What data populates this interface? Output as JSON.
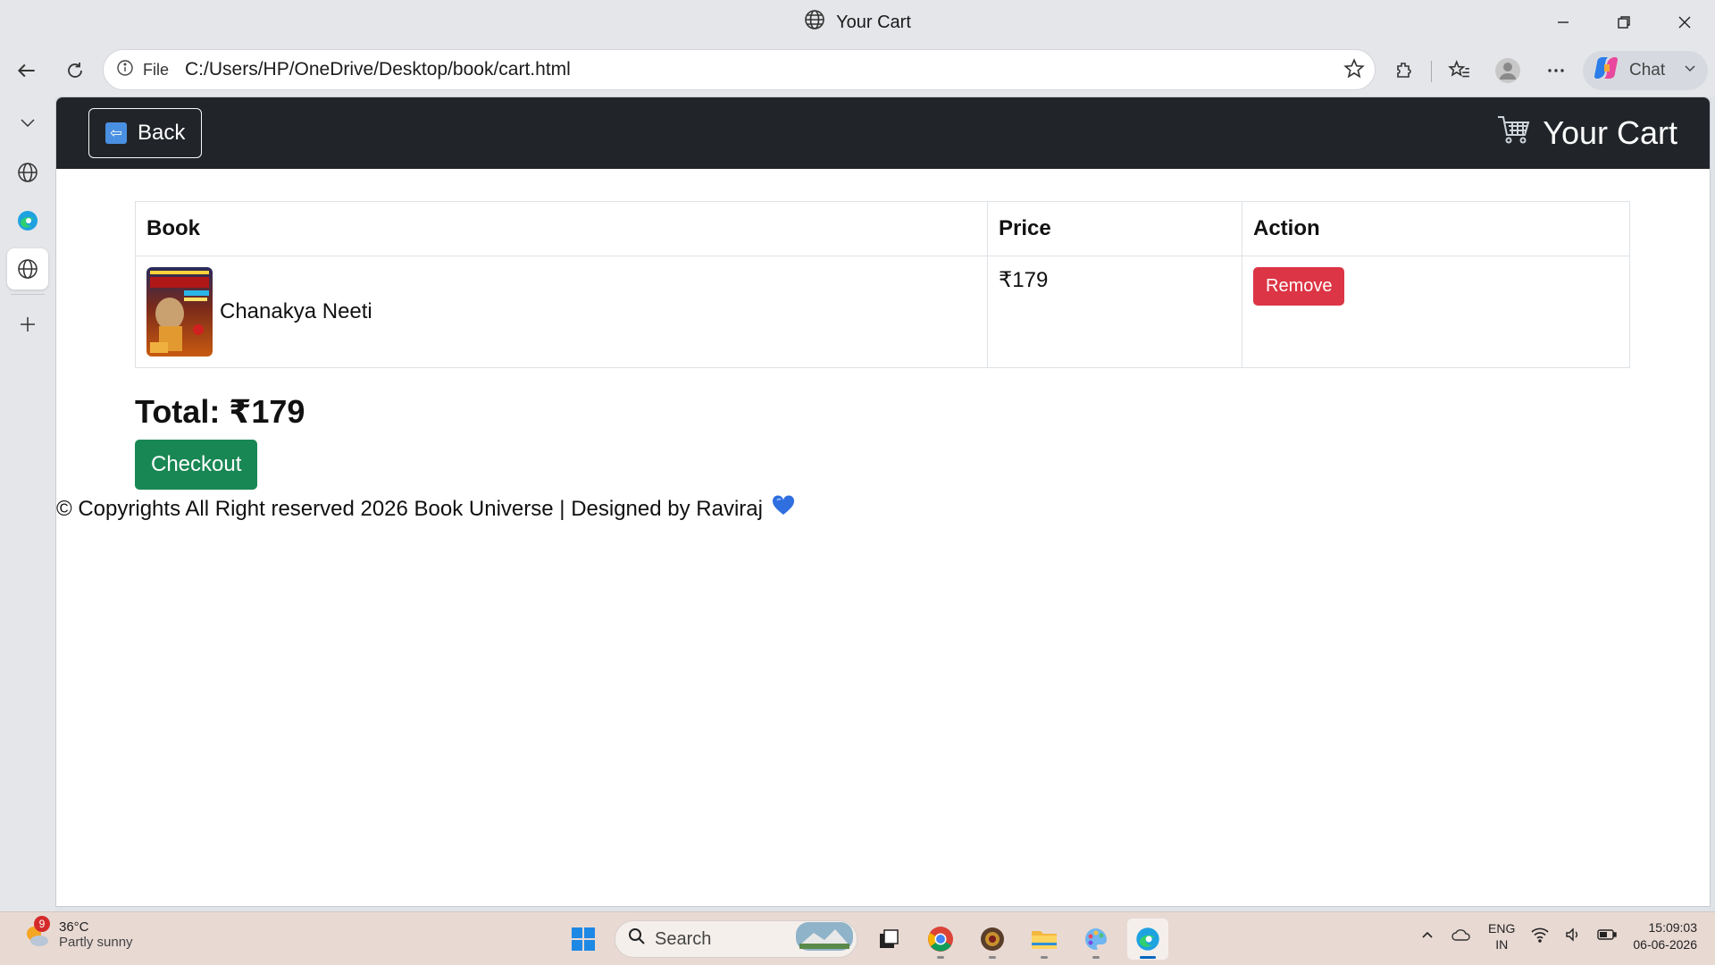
{
  "browser": {
    "tab_title": "Your Cart",
    "address_scheme_label": "File",
    "url": "C:/Users/HP/OneDrive/Desktop/book/cart.html",
    "chat_label": "Chat"
  },
  "page": {
    "navbar": {
      "back_label": "Back",
      "brand": "Your Cart"
    },
    "table": {
      "headers": [
        "Book",
        "Price",
        "Action"
      ],
      "rows": [
        {
          "title": "Chanakya Neeti",
          "price": "₹179",
          "action": "Remove"
        }
      ]
    },
    "total_label": "Total: ₹179",
    "checkout_label": "Checkout",
    "footer": "© Copyrights All Right reserved 2026 Book Universe | Designed by Raviraj"
  },
  "taskbar": {
    "weather_badge": "9",
    "temperature": "36°C",
    "condition": "Partly sunny",
    "search_placeholder": "Search",
    "lang_top": "ENG",
    "lang_bottom": "IN",
    "time": "15:09:03",
    "date": "06-06-2026"
  },
  "colors": {
    "navbar": "#212529",
    "remove": "#dc3545",
    "checkout": "#198754",
    "taskbar": "#e8d9d3"
  }
}
